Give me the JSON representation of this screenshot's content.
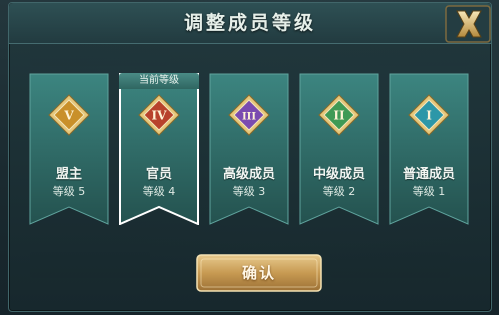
{
  "dialog": {
    "title": "调整成员等级",
    "confirm_label": "确认"
  },
  "current_tag": "当前等级",
  "ranks": [
    {
      "numeral": "V",
      "name": "盟主",
      "level": "等级 5",
      "badge_color": "#c9902a",
      "current": false
    },
    {
      "numeral": "IV",
      "name": "官员",
      "level": "等级 4",
      "badge_color": "#b8422c",
      "current": true
    },
    {
      "numeral": "III",
      "name": "高级成员",
      "level": "等级 3",
      "badge_color": "#7a4bb0",
      "current": false
    },
    {
      "numeral": "II",
      "name": "中级成员",
      "level": "等级 2",
      "badge_color": "#3f9a55",
      "current": false
    },
    {
      "numeral": "I",
      "name": "普通成员",
      "level": "等级 1",
      "badge_color": "#2c97a8",
      "current": false
    }
  ],
  "colors": {
    "card": "#2f6f6b",
    "card_selected_border": "#ffffff",
    "button_gold": "#d6ab63"
  }
}
